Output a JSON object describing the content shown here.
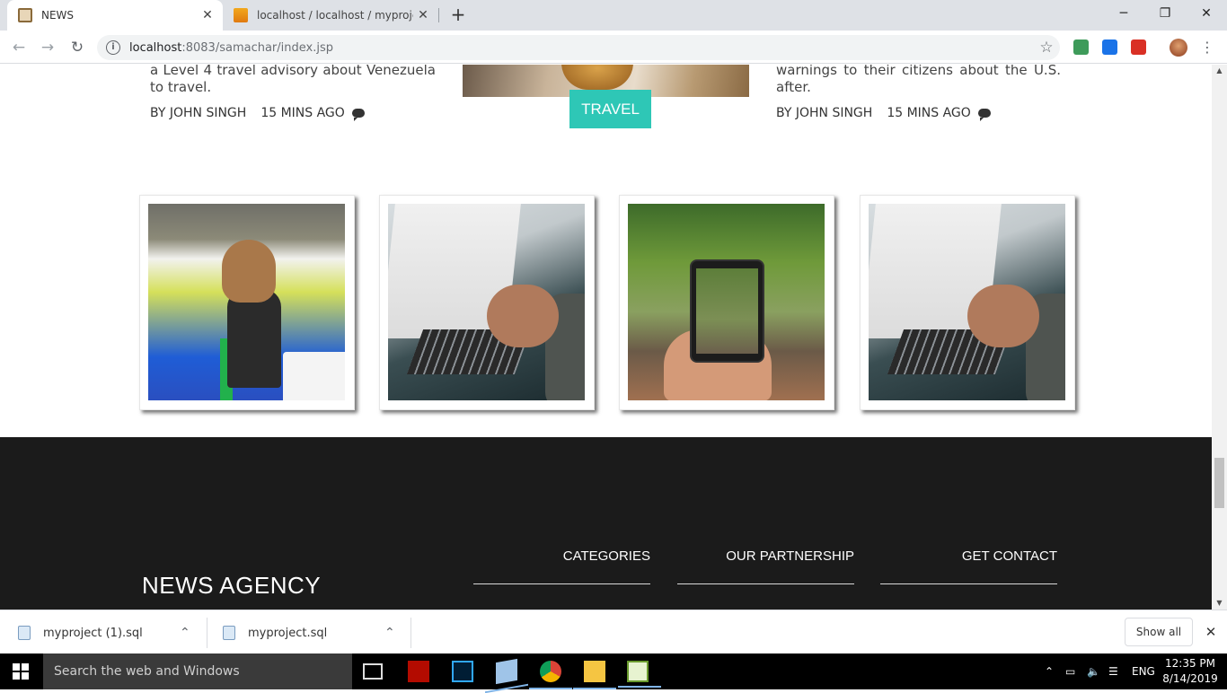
{
  "browser": {
    "tabs": [
      {
        "title": "NEWS",
        "active": true
      },
      {
        "title": "localhost / localhost / myproject",
        "active": false
      }
    ],
    "url_host": "localhost",
    "url_rest": ":8083/samachar/index.jsp"
  },
  "page": {
    "left_article": {
      "text": "a Level 4 travel advisory about Venezuela to travel.",
      "author": "BY JOHN SINGH",
      "time": "15 MINS AGO"
    },
    "center_article": {
      "badge": "TRAVEL"
    },
    "right_article": {
      "text": "warnings to their citizens about the U.S. after.",
      "author": "BY JOHN SINGH",
      "time": "15 MINS AGO"
    },
    "gallery": [
      {
        "subject": "child-drawing"
      },
      {
        "subject": "laptop-typing"
      },
      {
        "subject": "phone-forest"
      },
      {
        "subject": "laptop-typing"
      }
    ],
    "footer": {
      "brand": "NEWS AGENCY",
      "columns": [
        "CATEGORIES",
        "OUR PARTNERSHIP",
        "GET CONTACT"
      ]
    }
  },
  "downloads": {
    "items": [
      "myproject (1).sql",
      "myproject.sql"
    ],
    "show_all": "Show all"
  },
  "taskbar": {
    "search_placeholder": "Search the web and Windows",
    "language": "ENG",
    "time": "12:35 PM",
    "date": "8/14/2019"
  },
  "colors": {
    "badge": "#2ec7b6",
    "footer_bg": "#1b1b1b",
    "tabbar_bg": "#dee1e6"
  }
}
